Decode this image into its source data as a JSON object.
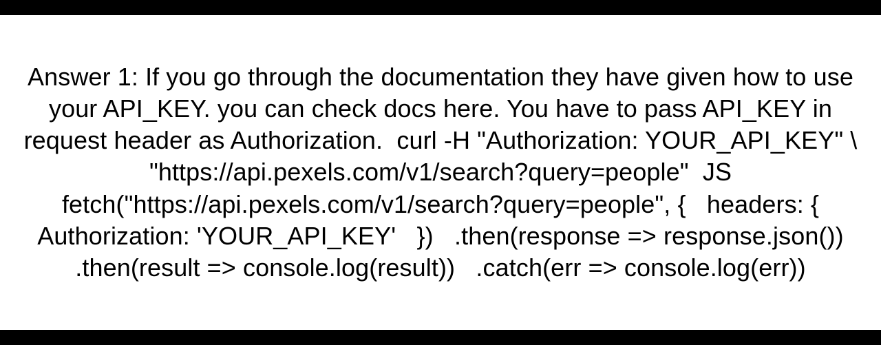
{
  "answer": {
    "text": "Answer 1: If you go through the documentation they have given how to use your API_KEY. you can check docs here. You have to pass API_KEY in request header as Authorization.  curl -H \"Authorization: YOUR_API_KEY\" \\   \"https://api.pexels.com/v1/search?query=people\"  JS fetch(\"https://api.pexels.com/v1/search?query=people\", {   headers: {     Authorization: 'YOUR_API_KEY'   })   .then(response => response.json())   .then(result => console.log(result))   .catch(err => console.log(err))"
  }
}
